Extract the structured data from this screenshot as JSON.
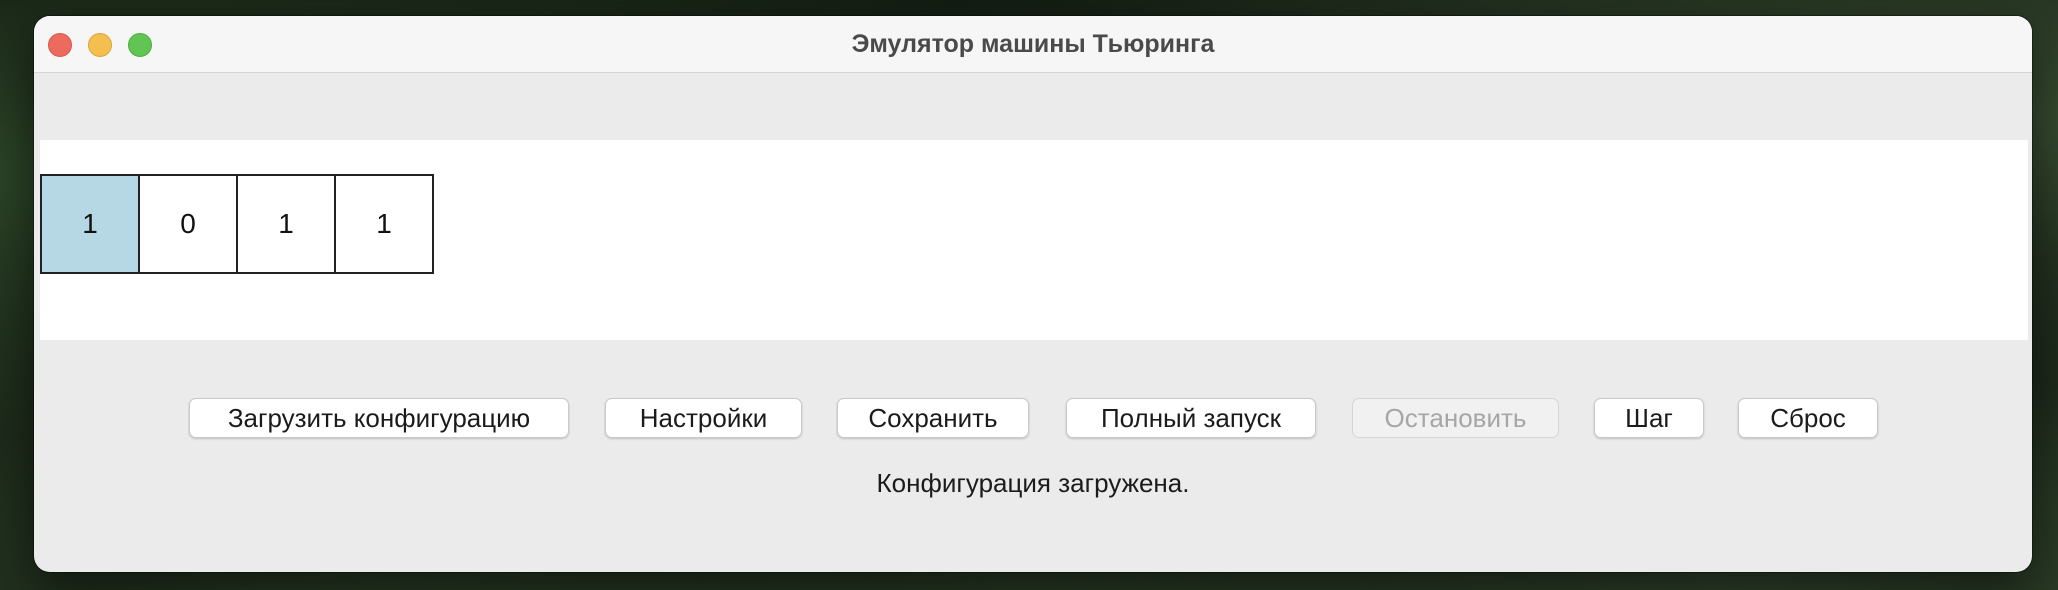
{
  "window": {
    "title": "Эмулятор машины Тьюринга"
  },
  "tape": {
    "head_index": 0,
    "head_color": "#b6d8e5",
    "cells": [
      "1",
      "0",
      "1",
      "1"
    ]
  },
  "toolbar": {
    "load_label": "Загрузить конфигурацию",
    "settings_label": "Настройки",
    "save_label": "Сохранить",
    "run_label": "Полный запуск",
    "stop_label": "Остановить",
    "step_label": "Шаг",
    "reset_label": "Сброс"
  },
  "status": {
    "message": "Конфигурация загружена."
  }
}
